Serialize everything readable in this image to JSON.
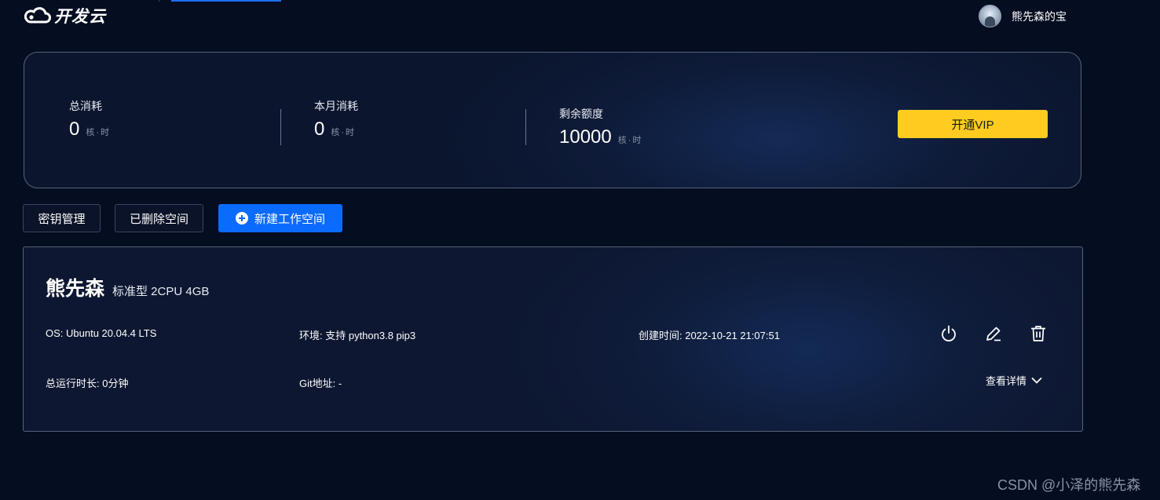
{
  "header": {
    "logo_text": "开发云",
    "user_name": "熊先森的宝"
  },
  "stats": {
    "total": {
      "label": "总消耗",
      "value": "0",
      "unit": "核·时"
    },
    "month": {
      "label": "本月消耗",
      "value": "0",
      "unit": "核·时"
    },
    "remaining": {
      "label": "剩余额度",
      "value": "10000",
      "unit": "核·时"
    },
    "vip_button": "开通VIP"
  },
  "actions": {
    "key_manage": "密钥管理",
    "deleted_spaces": "已删除空间",
    "new_workspace": "新建工作空间"
  },
  "workspace": {
    "name": "熊先森",
    "spec": "标准型 2CPU 4GB",
    "os": "OS: Ubuntu 20.04.4 LTS",
    "env": "环境: 支持 python3.8 pip3",
    "created": "创建时间: 2022-10-21 21:07:51",
    "runtime": "总运行时长: 0分钟",
    "git": "Git地址: -",
    "detail_link": "查看详情",
    "icons": [
      "power-icon",
      "edit-icon",
      "delete-icon"
    ]
  },
  "watermark": "CSDN @小泽的熊先森",
  "colors": {
    "background": "#050d20",
    "accent_blue": "#0b6bff",
    "vip_yellow": "#ffcc1f"
  }
}
